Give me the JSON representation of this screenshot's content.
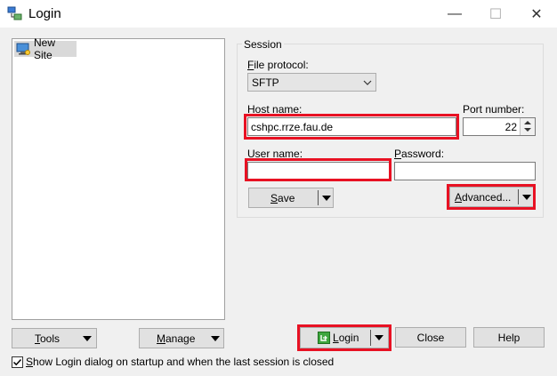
{
  "window": {
    "title": "Login",
    "controls": {
      "minimize": "—",
      "maximize": "☐",
      "close": "✕"
    }
  },
  "sites": [
    {
      "label": "New Site",
      "icon": "computer-icon",
      "selected": true
    }
  ],
  "session": {
    "group_label": "Session",
    "file_protocol": {
      "label_u": "F",
      "label_rest": "ile protocol:",
      "value": "SFTP"
    },
    "host_name": {
      "label_u": "H",
      "label_rest": "ost name:",
      "value": "cshpc.rrze.fau.de"
    },
    "port_number": {
      "label_u": "",
      "label_rest": "Port number:",
      "value": "22"
    },
    "user_name": {
      "label_u": "U",
      "label_rest": "ser name:",
      "value": ""
    },
    "password": {
      "label_u": "P",
      "label_rest": "assword:",
      "value": ""
    },
    "save_button": {
      "label_u": "S",
      "label_rest": "ave"
    },
    "advanced_button": {
      "label_u": "A",
      "label_rest": "dvanced..."
    }
  },
  "bottom": {
    "tools_button": {
      "label_u": "T",
      "label_rest": "ools"
    },
    "manage_button": {
      "label_u": "M",
      "label_rest": "anage"
    },
    "login_button": {
      "label_u": "L",
      "label_rest": "ogin"
    },
    "close_button": "Close",
    "help_button": "Help"
  },
  "startup_checkbox": {
    "checked": true,
    "label_u": "S",
    "label_rest": "how Login dialog on startup and when the last session is closed"
  },
  "colors": {
    "highlight": "#e81123",
    "login_icon": "#3ea63e"
  }
}
